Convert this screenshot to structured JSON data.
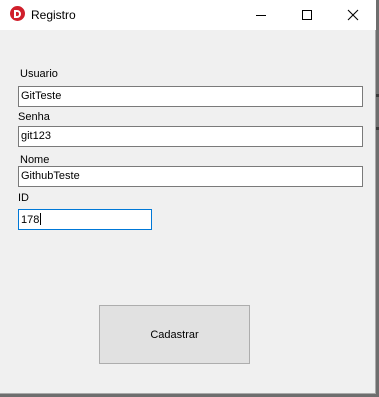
{
  "window": {
    "title": "Registro",
    "icon": "app-d-logo-icon",
    "accent": "#d01f2b"
  },
  "titlebar": {
    "minimize_icon": "minimize-icon",
    "maximize_icon": "maximize-icon",
    "close_icon": "close-icon"
  },
  "form": {
    "usuario": {
      "label": "Usuario",
      "value": "GitTeste"
    },
    "senha": {
      "label": "Senha",
      "value": "git123"
    },
    "nome": {
      "label": "Nome",
      "value": "GithubTeste"
    },
    "id": {
      "label": "ID",
      "value": "178"
    }
  },
  "actions": {
    "submit_label": "Cadastrar"
  },
  "colors": {
    "focus_border": "#0078d7",
    "window_bg": "#f0f0f0",
    "button_bg": "#e1e1e1"
  }
}
